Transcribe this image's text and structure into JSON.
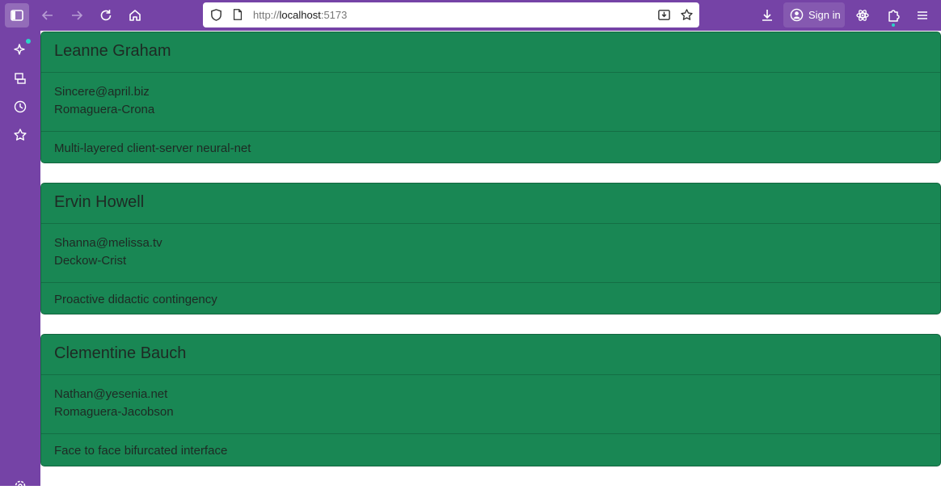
{
  "browser": {
    "url_prefix": "http://",
    "url_host": "localhost",
    "url_suffix": ":5173",
    "signin_label": "Sign in"
  },
  "users": [
    {
      "name": "Leanne Graham",
      "email": "Sincere@april.biz",
      "company": "Romaguera-Crona",
      "catchphrase": "Multi-layered client-server neural-net"
    },
    {
      "name": "Ervin Howell",
      "email": "Shanna@melissa.tv",
      "company": "Deckow-Crist",
      "catchphrase": "Proactive didactic contingency"
    },
    {
      "name": "Clementine Bauch",
      "email": "Nathan@yesenia.net",
      "company": "Romaguera-Jacobson",
      "catchphrase": "Face to face bifurcated interface"
    }
  ],
  "colors": {
    "browser_chrome": "#7543a6",
    "card_background": "#198754",
    "notification_dot": "#2bd3c7"
  }
}
